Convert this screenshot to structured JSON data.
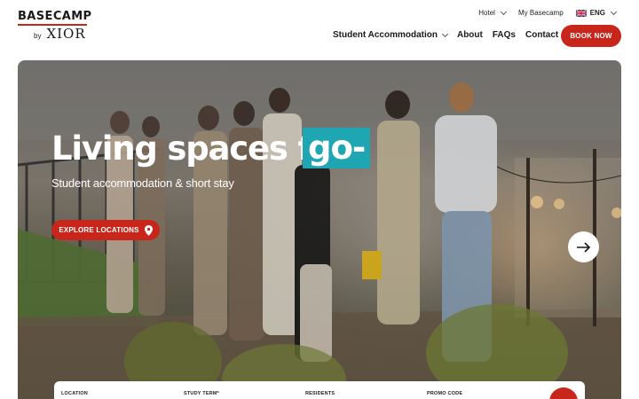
{
  "header": {
    "logo": {
      "brand": "BASECAMP",
      "by": "by",
      "partner": "XIOR"
    },
    "topbar": {
      "hotel": "Hotel",
      "my_basecamp": "My Basecamp",
      "language": "ENG"
    },
    "nav": [
      {
        "label": "Student Accommodation",
        "dropdown": true
      },
      {
        "label": "About"
      },
      {
        "label": "FAQs"
      },
      {
        "label": "Contact"
      }
    ],
    "book_button": "BOOK NOW"
  },
  "hero": {
    "title": "Living spaces for",
    "title_accent": "go-",
    "subtitle": "Student accommodation & short stay",
    "explore_button": "EXPLORE LOCATIONS",
    "explore_icon": "location-pin-icon",
    "next_icon": "arrow-right-icon"
  },
  "search": {
    "fields": [
      "LOCATION",
      "STUDY TERM*",
      "RESIDENTS",
      "PROMO CODE"
    ]
  },
  "colors": {
    "accent_red": "#c8261b",
    "highlight_teal": "#1ea7b3",
    "text_dark": "#1a1a1a",
    "white": "#ffffff"
  }
}
